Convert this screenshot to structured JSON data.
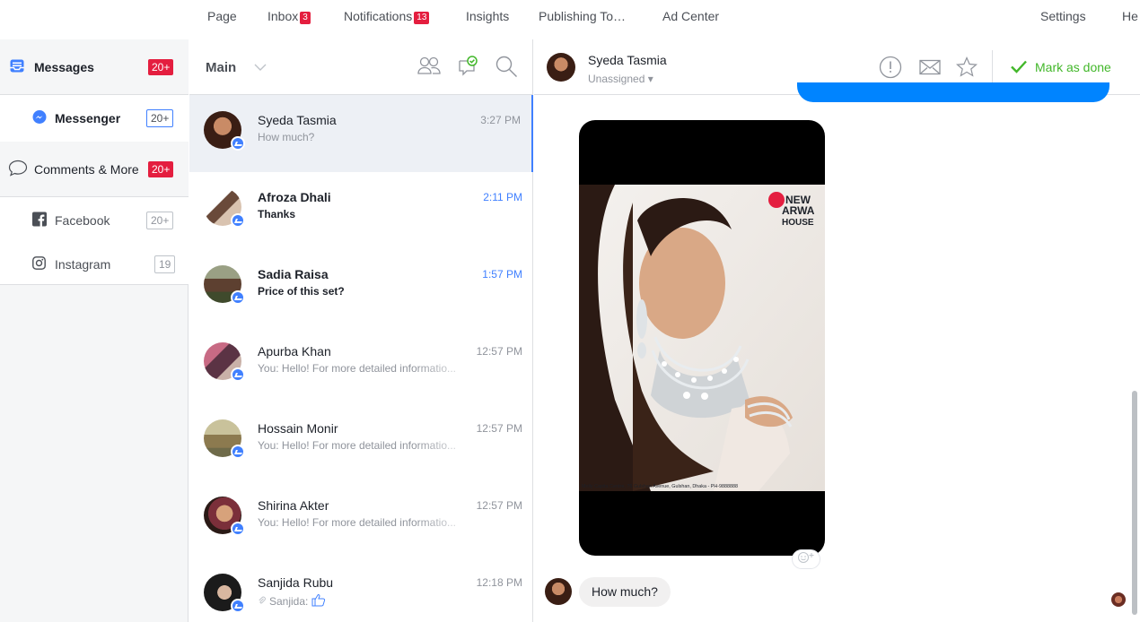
{
  "topnav": {
    "items": [
      {
        "label": "Page"
      },
      {
        "label": "Inbox",
        "badge": "3"
      },
      {
        "label": "Notifications",
        "badge": "13"
      },
      {
        "label": "Insights"
      },
      {
        "label": "Publishing To…"
      },
      {
        "label": "Ad Center"
      }
    ],
    "settings": "Settings",
    "help": "He"
  },
  "sidebar": {
    "items": [
      {
        "label": "Messages",
        "count": "20+",
        "icon": "inbox-tray-icon"
      },
      {
        "label": "Messenger",
        "count": "20+",
        "icon": "messenger-icon"
      },
      {
        "label": "Comments & More",
        "count": "20+",
        "icon": "comment-bubble-icon"
      },
      {
        "label": "Facebook",
        "count": "20+",
        "icon": "facebook-icon"
      },
      {
        "label": "Instagram",
        "count": "19",
        "icon": "instagram-icon"
      }
    ]
  },
  "conversations": {
    "title": "Main",
    "threads": [
      {
        "name": "Syeda Tasmia",
        "snippet": "How much?",
        "time": "3:27 PM"
      },
      {
        "name": "Afroza Dhali",
        "snippet": "Thanks",
        "time": "2:11 PM"
      },
      {
        "name": "Sadia Raisa",
        "snippet": "Price of this set?",
        "time": "1:57 PM"
      },
      {
        "name": "Apurba Khan",
        "snippet": "You: Hello! For more detailed informatio...",
        "time": "12:57 PM"
      },
      {
        "name": "Hossain Monir",
        "snippet": "You: Hello! For more detailed informatio...",
        "time": "12:57 PM"
      },
      {
        "name": "Shirina Akter",
        "snippet": "You: Hello! For more detailed informatio...",
        "time": "12:57 PM"
      },
      {
        "name": "Sanjida Rubu",
        "snippet": "Sanjida:",
        "time": "12:18 PM"
      }
    ]
  },
  "chat": {
    "contact_name": "Syeda Tasmia",
    "assignment": "Unassigned",
    "mark_done": "Mark as done",
    "photo_logo_line1": "NEW",
    "photo_logo_line2": "ARWA",
    "photo_logo_line3": "HOUSE",
    "photo_address": "Molly Capita Centre, 76 Gulshan Avenue, Gulshan, Dhaka - PH-9888888",
    "incoming_message": "How much?"
  },
  "colors": {
    "accent": "#4080ff",
    "badge_red": "#e41e3f",
    "done_green": "#42b72a",
    "sent_bubble": "#0084ff"
  }
}
